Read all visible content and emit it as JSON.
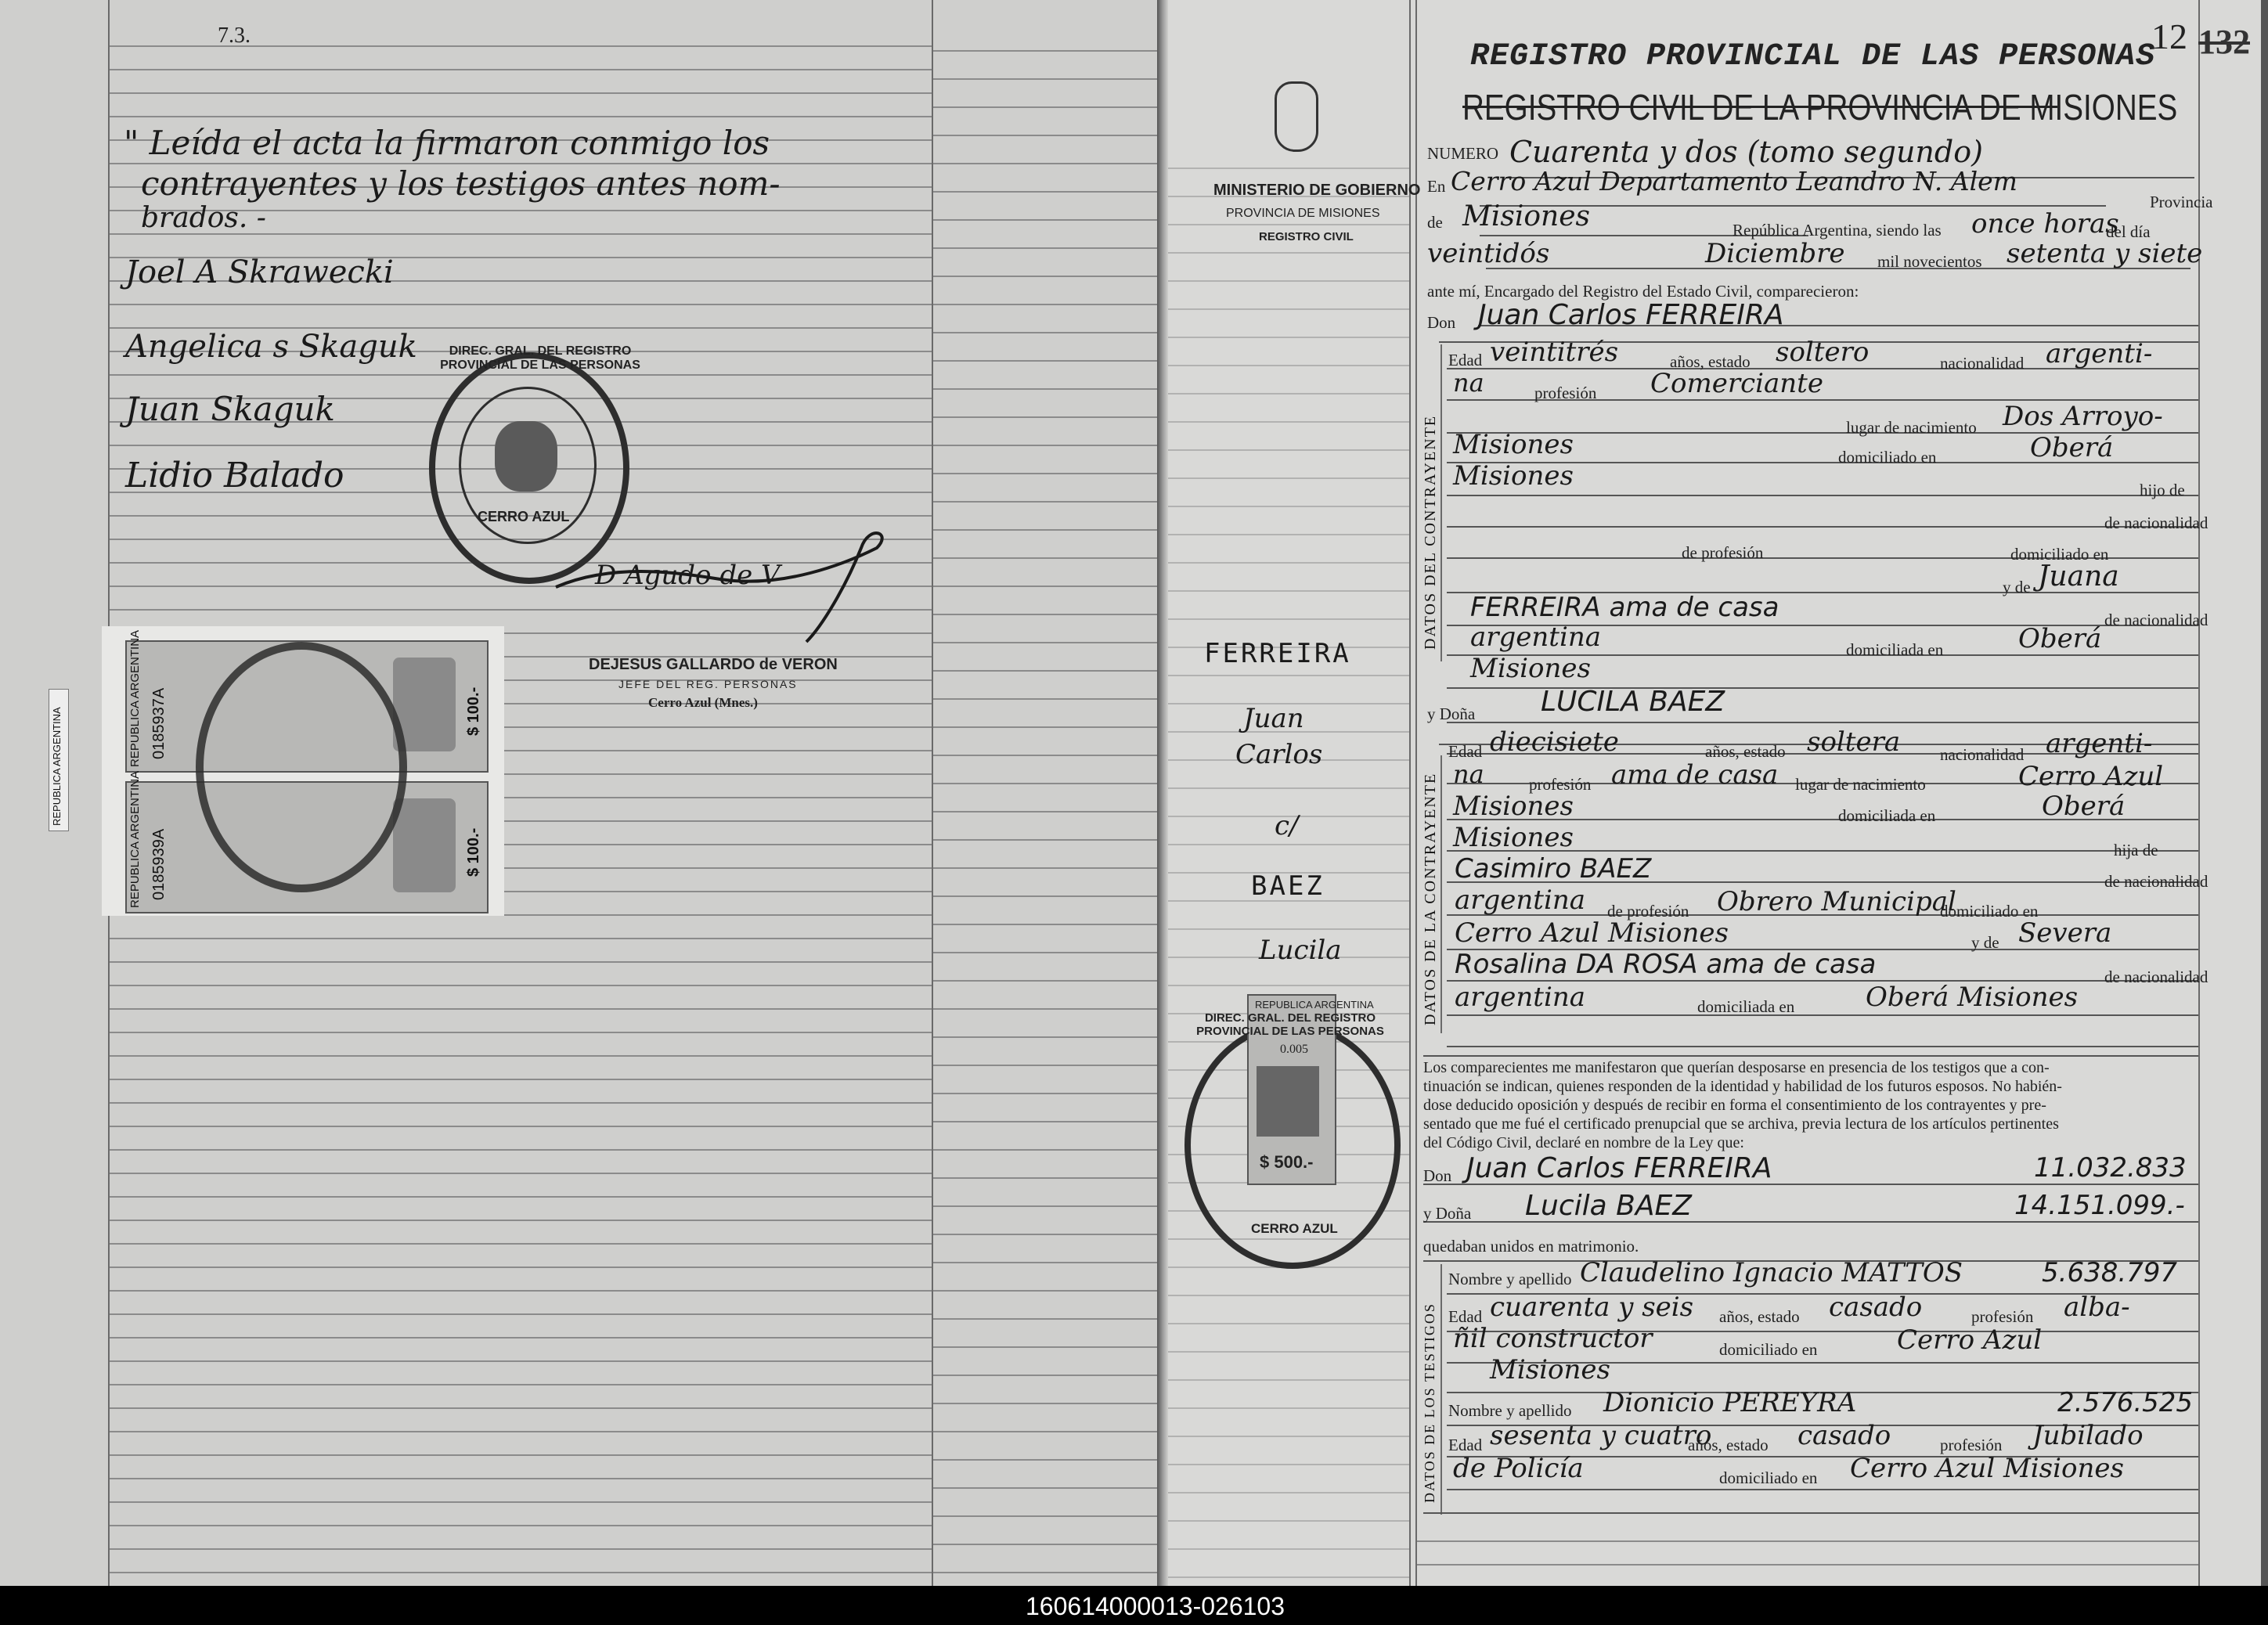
{
  "footer": {
    "code": "160614000013-026103"
  },
  "left_page": {
    "corner_mark": "7.3.",
    "closing_text": [
      "\" Leída el acta la firmaron conmigo los",
      "contrayentes y los testigos antes nom-",
      "brados. -"
    ],
    "signatures": [
      "Joel A Skrawecki",
      "Angelica s Skaguk",
      "Juan Skaguk",
      "Lidio Balado"
    ],
    "official_signature": "D Agudo de V",
    "official_stamp": {
      "name": "DEJESUS GALLARDO de VERON",
      "title": "JEFE DEL REG. PERSONAS",
      "place": "Cerro Azul (Mnes.)"
    },
    "seal_text": "DIREC. GRAL. DEL REGISTRO PROVINCIAL DE LAS PERSONAS",
    "seal_place": "CERRO AZUL",
    "fee_stamps": [
      {
        "serial": "0185937A",
        "value": "$ 100.-",
        "country": "REPUBLICA ARGENTINA"
      },
      {
        "serial": "0185939A",
        "value": "$ 100.-",
        "country": "REPUBLICA ARGENTINA"
      }
    ],
    "edge_label": "REPUBLICA ARGENTINA"
  },
  "right_page": {
    "page_number": "12",
    "page_number_struck": "132",
    "header_stamp": "REGISTRO PROVINCIAL DE LAS PERSONAS",
    "header_printed": "REGISTRO CIVIL DE LA PROVINCIA DE MISIONES",
    "ministry": [
      "MINISTERIO DE GOBIERNO",
      "PROVINCIA DE MISIONES",
      "REGISTRO CIVIL"
    ],
    "margin_names": [
      "FERREIRA",
      "Juan",
      "Carlos",
      "c/",
      "BAEZ",
      "Lucila"
    ],
    "seal_value": "$ 500.-",
    "seal_stamp_serial": "0.005",
    "seal_country": "REPUBLICA ARGENTINA",
    "seal_text": "DIREC. GRAL. DEL REGISTRO PROVINCIAL DE LAS PERSONAS",
    "seal_place": "CERRO AZUL",
    "labels": {
      "numero": "NUMERO",
      "en": "En",
      "provincia": "Provincia",
      "de": "de",
      "republica": "República Argentina, siendo las",
      "del_dia": "del día",
      "mil": "mil novecientos",
      "ante": "ante mí, Encargado del Registro del Estado Civil, comparecieron:",
      "don": "Don",
      "edad": "Edad",
      "anos_estado": "años, estado",
      "nacionalidad": "nacionalidad",
      "profesion": "profesión",
      "lugar_nac": "lugar de nacimiento",
      "domiciliado_en": "domiciliado en",
      "hijo_de": "hijo de",
      "de_nacionalidad": "de nacionalidad",
      "de_profesion": "de profesión",
      "domiciliado_en2": "domiciliado en",
      "y_de": "y de",
      "domiciliada_en": "domiciliada en",
      "y_dona": "y Doña",
      "hija_de": "hija de",
      "datos_contrayente": "DATOS DEL CONTRAYENTE",
      "datos_contrayente_f": "DATOS DE LA CONTRAYENTE",
      "datos_testigos": "DATOS DE LOS TESTIGOS",
      "nombre_apellido": "Nombre y apellido",
      "quedaban": "quedaban unidos en matrimonio.",
      "don2": "Don",
      "y_dona2": "y Doña"
    },
    "declaration": [
      "Los comparecientes me manifestaron que querían desposarse en presencia de los testigos que a con-",
      "tinuación se indican, quienes responden de la identidad y habilidad de los futuros esposos. No habién-",
      "dose deducido oposición y después de recibir en forma el consentimiento de los contrayentes y pre-",
      "sentado que me fué el certificado prenupcial que se archiva, previa lectura de los artículos pertinentes",
      "del Código Civil, declaré en nombre de la Ley que:"
    ],
    "entries": {
      "numero": "Cuarenta y dos (tomo segundo)",
      "lugar": "Cerro Azul Departamento Leandro N. Alem",
      "provincia": "Misiones",
      "hora": "once horas",
      "dia": "veintidós",
      "mes": "Diciembre",
      "anio": "setenta y siete",
      "novio": "Juan Carlos FERREIRA",
      "novio_edad": "veintitrés",
      "novio_estado": "soltero",
      "novio_nac": "argenti-",
      "novio_nac2": "na",
      "novio_prof": "Comerciante",
      "novio_lugar_nac": "Dos Arroyo-",
      "novio_lugar_nac2": "Misiones",
      "novio_dom": "Oberá",
      "novio_dom2": "Misiones",
      "madre_novio": "Juana",
      "madre_novio_ap": "FERREIRA ama de casa",
      "madre_novio_nac": "argentina",
      "madre_novio_dom": "Oberá",
      "madre_novio_dom2": "Misiones",
      "novia": "LUCILA BAEZ",
      "novia_edad": "diecisiete",
      "novia_estado": "soltera",
      "novia_nac": "argenti-",
      "novia_nac2": "na",
      "novia_prof": "ama de casa",
      "novia_lugar_nac": "Cerro Azul",
      "novia_lugar_nac2": "Misiones",
      "novia_dom": "Oberá",
      "novia_dom2": "Misiones",
      "padre_novia": "Casimiro BAEZ",
      "padre_novia_nac": "argentina",
      "padre_novia_prof": "Obrero Municipal",
      "padre_novia_dom": "Cerro Azul Misiones",
      "madre_novia": "Severa",
      "madre_novia_ap": "Rosalina DA ROSA ama de casa",
      "madre_novia_nac": "argentina",
      "madre_novia_dom": "Oberá Misiones",
      "decl_novio": "Juan Carlos FERREIRA",
      "decl_novio_doc": "11.032.833",
      "decl_novia": "Lucila BAEZ",
      "decl_novia_doc": "14.151.099.-",
      "testigo1": "Claudelino Ignacio MATTOS",
      "testigo1_doc": "5.638.797",
      "testigo1_edad": "cuarenta y seis",
      "testigo1_estado": "casado",
      "testigo1_prof": "alba-",
      "testigo1_prof2": "ñil constructor",
      "testigo1_dom": "Cerro Azul",
      "testigo1_dom2": "Misiones",
      "testigo2": "Dionicio PEREYRA",
      "testigo2_doc": "2.576.525",
      "testigo2_edad": "sesenta y cuatro",
      "testigo2_estado": "casado",
      "testigo2_prof": "Jubilado",
      "testigo2_prof2": "de Policía",
      "testigo2_dom": "Cerro Azul Misiones"
    }
  }
}
